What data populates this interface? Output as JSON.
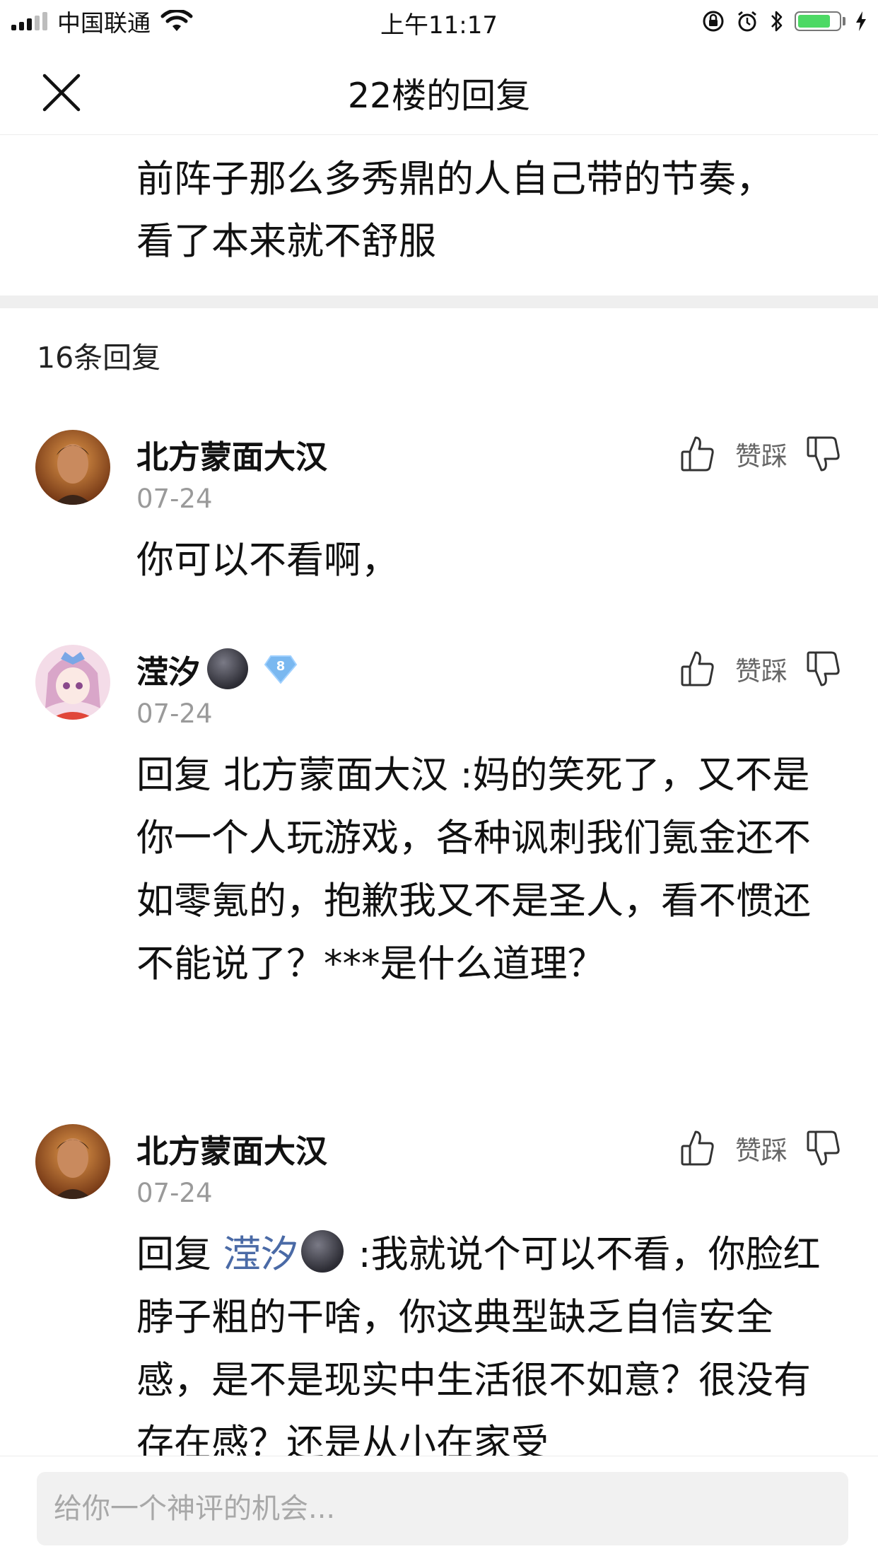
{
  "status_bar": {
    "carrier": "中国联通",
    "time": "上午11:17"
  },
  "nav": {
    "title": "22楼的回复"
  },
  "main_post": {
    "text": "前阵子那么多秀鼎的人自己带的节奏，看了本来就不舒服"
  },
  "reply_count": "16条回复",
  "vote_label": "赞踩",
  "comments": [
    {
      "author": "北方蒙面大汉",
      "date": "07-24",
      "text": "你可以不看啊，"
    },
    {
      "author": "滢汐",
      "level": "8",
      "date": "07-24",
      "prefix": "回复 北方蒙面大汉 :",
      "text": "妈的笑死了，又不是你一个人玩游戏，各种讽刺我们氪金还不如零氪的，抱歉我又不是圣人，看不惯还不能说了？***是什么道理？"
    },
    {
      "author": "北方蒙面大汉",
      "date": "07-24",
      "prefix": "回复 ",
      "mention": "滢汐",
      "text": " :我就说个可以不看，你脸红脖子粗的干啥，你这典型缺乏自信安全感，是不是现实中生活很不如意？很没有存在感？还是从小在家受"
    }
  ],
  "input": {
    "placeholder": "给你一个神评的机会..."
  },
  "colors": {
    "accent_mention": "#4a6aa6",
    "battery": "#4cd964",
    "level_badge": "#7ab8f0"
  }
}
